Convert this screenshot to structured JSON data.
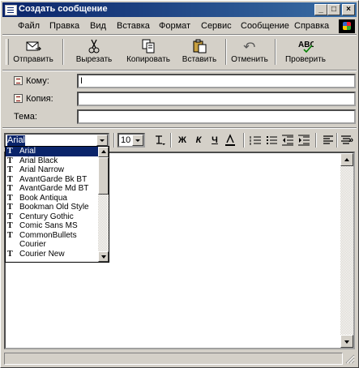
{
  "window": {
    "title": "Создать сообщение"
  },
  "menu": [
    "Файл",
    "Правка",
    "Вид",
    "Вставка",
    "Формат",
    "Сервис",
    "Сообщение",
    "Справка"
  ],
  "toolbar": {
    "send": "Отправить",
    "cut": "Вырезать",
    "copy": "Копировать",
    "paste": "Вставить",
    "undo": "Отменить",
    "check": "Проверить"
  },
  "header": {
    "to_label": "Кому:",
    "to_value": "I",
    "cc_label": "Копия:",
    "cc_value": "",
    "subject_label": "Тема:",
    "subject_value": ""
  },
  "format": {
    "font_value": "Arial",
    "size_value": "10",
    "bold": "Ж",
    "italic": "К",
    "underline": "Ч",
    "more": "»"
  },
  "font_list": {
    "selected": "Arial",
    "items": [
      "Arial",
      "Arial Black",
      "Arial Narrow",
      "AvantGarde Bk BT",
      "AvantGarde Md BT",
      "Book Antiqua",
      "Bookman Old Style",
      "Century Gothic",
      "Comic Sans MS",
      "CommonBullets",
      "Courier",
      "Courier New"
    ]
  }
}
